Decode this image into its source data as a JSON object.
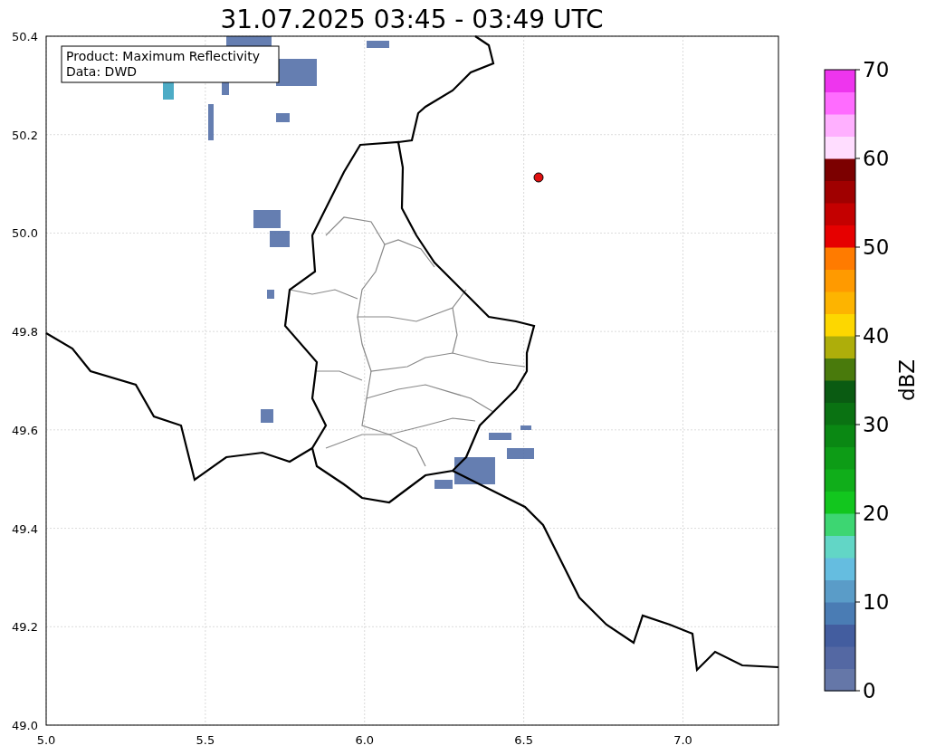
{
  "title": "31.07.2025 03:45 - 03:49 UTC",
  "map": {
    "info_lines": [
      "Product: Maximum Reflectivity",
      "Data: DWD"
    ],
    "xticks": [
      "5.0",
      "5.5",
      "6.0",
      "6.5",
      "7.0"
    ],
    "yticks": [
      "50.4",
      "50.2",
      "50.0",
      "49.8",
      "49.6",
      "49.4",
      "49.2",
      "49.0"
    ]
  },
  "colorbar": {
    "label": "dBZ",
    "ticks": [
      "70",
      "60",
      "50",
      "40",
      "30",
      "20",
      "10",
      "0"
    ],
    "segments": [
      {
        "color": "#6577a8"
      },
      {
        "color": "#5468a3"
      },
      {
        "color": "#435d9f"
      },
      {
        "color": "#4a7cb4"
      },
      {
        "color": "#5a9cc8"
      },
      {
        "color": "#65bde0"
      },
      {
        "color": "#62d6c6"
      },
      {
        "color": "#3dd672"
      },
      {
        "color": "#12c61e"
      },
      {
        "color": "#10ae1a"
      },
      {
        "color": "#0d9c16"
      },
      {
        "color": "#0a8813"
      },
      {
        "color": "#0a7212"
      },
      {
        "color": "#0a5b12"
      },
      {
        "color": "#497a0c"
      },
      {
        "color": "#aeae0a"
      },
      {
        "color": "#fdd700"
      },
      {
        "color": "#fdb400"
      },
      {
        "color": "#ff9a00"
      },
      {
        "color": "#ff7b00"
      },
      {
        "color": "#e60000"
      },
      {
        "color": "#c40000"
      },
      {
        "color": "#a00000"
      },
      {
        "color": "#7c0000"
      },
      {
        "color": "#ffddff"
      },
      {
        "color": "#ffb0ff"
      },
      {
        "color": "#ff6cff"
      },
      {
        "color": "#ee35ee"
      }
    ]
  }
}
